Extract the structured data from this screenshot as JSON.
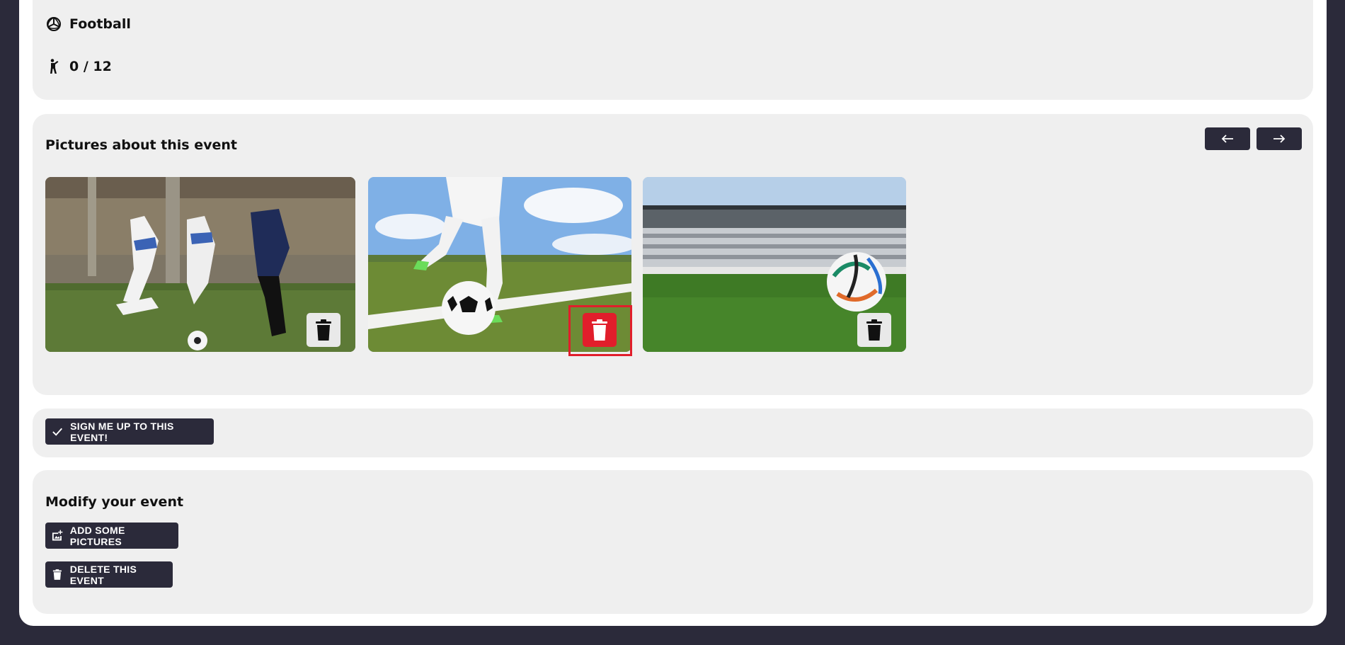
{
  "event_info": {
    "sport": "Football",
    "participants": "0 / 12"
  },
  "pictures": {
    "title": "Pictures about this event",
    "prev_icon": "arrow-left-icon",
    "next_icon": "arrow-right-icon",
    "items": [
      {
        "subject": "women's football match",
        "action_icon": "trash-icon"
      },
      {
        "subject": "player kicking ball on pitch",
        "action_icon": "trash-icon",
        "state": "hovered"
      },
      {
        "subject": "ball in empty stadium",
        "action_icon": "trash-icon"
      }
    ]
  },
  "signup": {
    "label": "SIGN ME UP TO THIS EVENT!",
    "icon": "check-icon"
  },
  "modify": {
    "title": "Modify your event",
    "add_pictures_label": "ADD SOME PICTURES",
    "add_pictures_icon": "add-photo-icon",
    "delete_event_label": "DELETE THIS EVENT",
    "delete_event_icon": "trash-icon"
  },
  "colors": {
    "background": "#2b2a3a",
    "card": "#efefef",
    "button": "#2b2a3a",
    "danger": "#e11e2b"
  }
}
